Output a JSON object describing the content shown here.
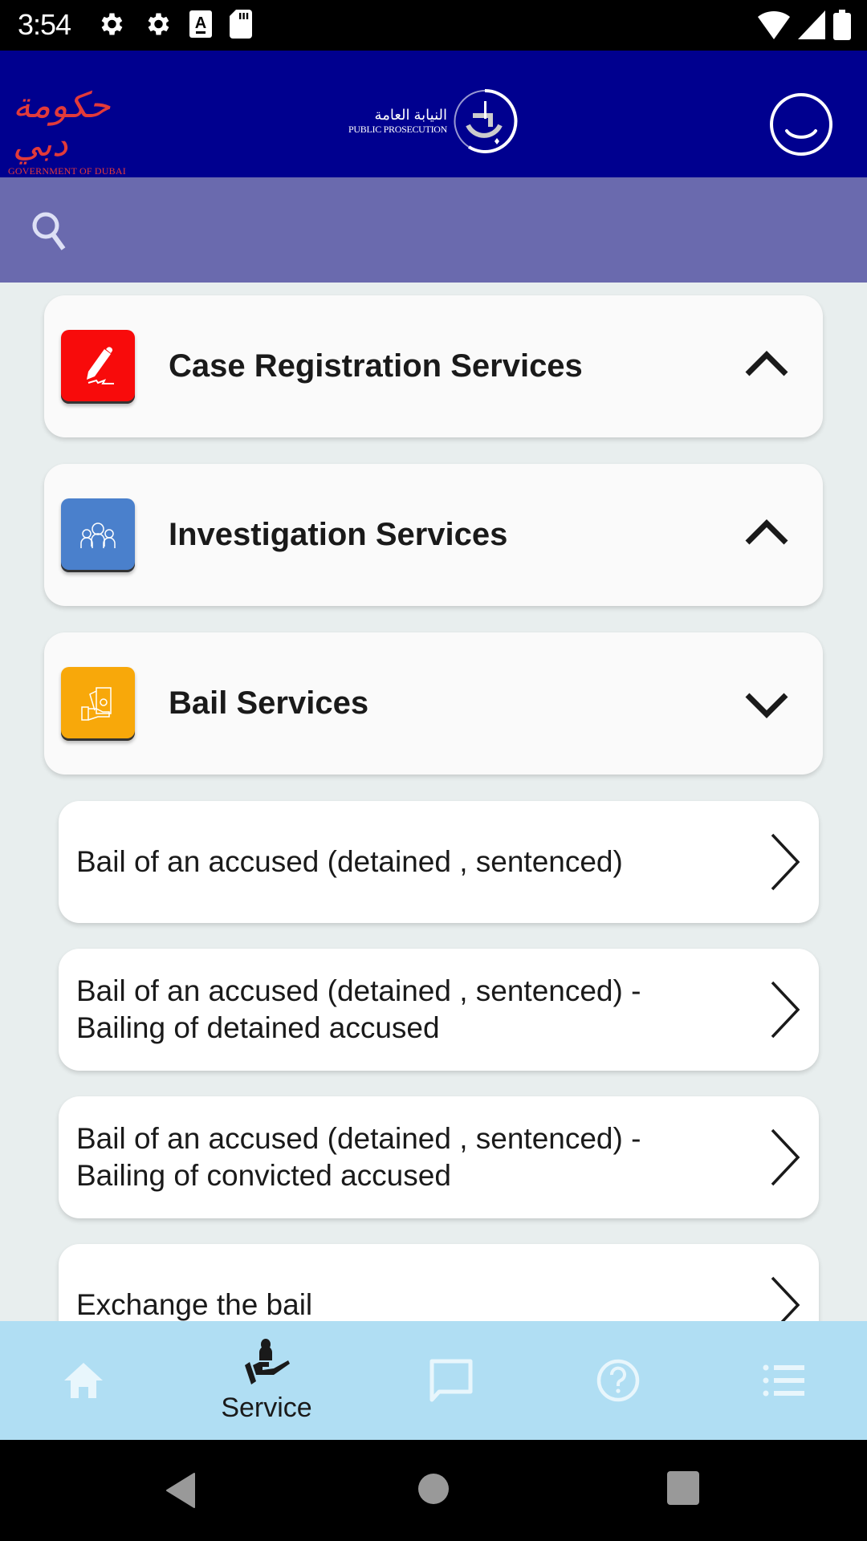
{
  "status_bar": {
    "time": "3:54",
    "left_icons": [
      "settings-icon",
      "settings-icon",
      "keyboard-a-icon",
      "sd-card-icon"
    ],
    "right_icons": [
      "wifi-icon",
      "signal-icon",
      "battery-icon"
    ]
  },
  "header": {
    "gov_logo": {
      "arabic": "حكومة دبي",
      "english": "GOVERNMENT OF DUBAI"
    },
    "pp_logo": {
      "arabic": "النيابة العامة",
      "english": "PUBLIC PROSECUTION"
    },
    "profile_icon": "smiley-profile-icon"
  },
  "search": {
    "placeholder": "",
    "value": ""
  },
  "categories": [
    {
      "label": "Case Registration Services",
      "icon": "pen-signature-icon",
      "color": "#f80b0b",
      "state": "collapsed-chevron-up"
    },
    {
      "label": "Investigation Services",
      "icon": "people-group-icon",
      "color": "#4a80cc",
      "state": "collapsed-chevron-up"
    },
    {
      "label": "Bail Services",
      "icon": "money-hand-icon",
      "color": "#f8a80a",
      "state": "expanded-chevron-down"
    }
  ],
  "bail_services": [
    {
      "label": "Bail of an accused (detained , sentenced)"
    },
    {
      "label": "Bail of an accused (detained , sentenced) - Bailing of detained accused"
    },
    {
      "label": "Bail of an accused (detained , sentenced) - Bailing of convicted accused"
    },
    {
      "label": "Exchange the bail"
    }
  ],
  "bottom_nav": {
    "items": [
      {
        "name": "home",
        "label": "",
        "active": false
      },
      {
        "name": "service",
        "label": "Service",
        "active": true
      },
      {
        "name": "chat",
        "label": "",
        "active": false
      },
      {
        "name": "help",
        "label": "",
        "active": false
      },
      {
        "name": "menu",
        "label": "",
        "active": false
      }
    ]
  },
  "colors": {
    "header_bg": "#00008f",
    "search_bg": "#6a6aae",
    "content_bg": "#e8eeee",
    "bottom_nav_bg": "#b0def3"
  }
}
